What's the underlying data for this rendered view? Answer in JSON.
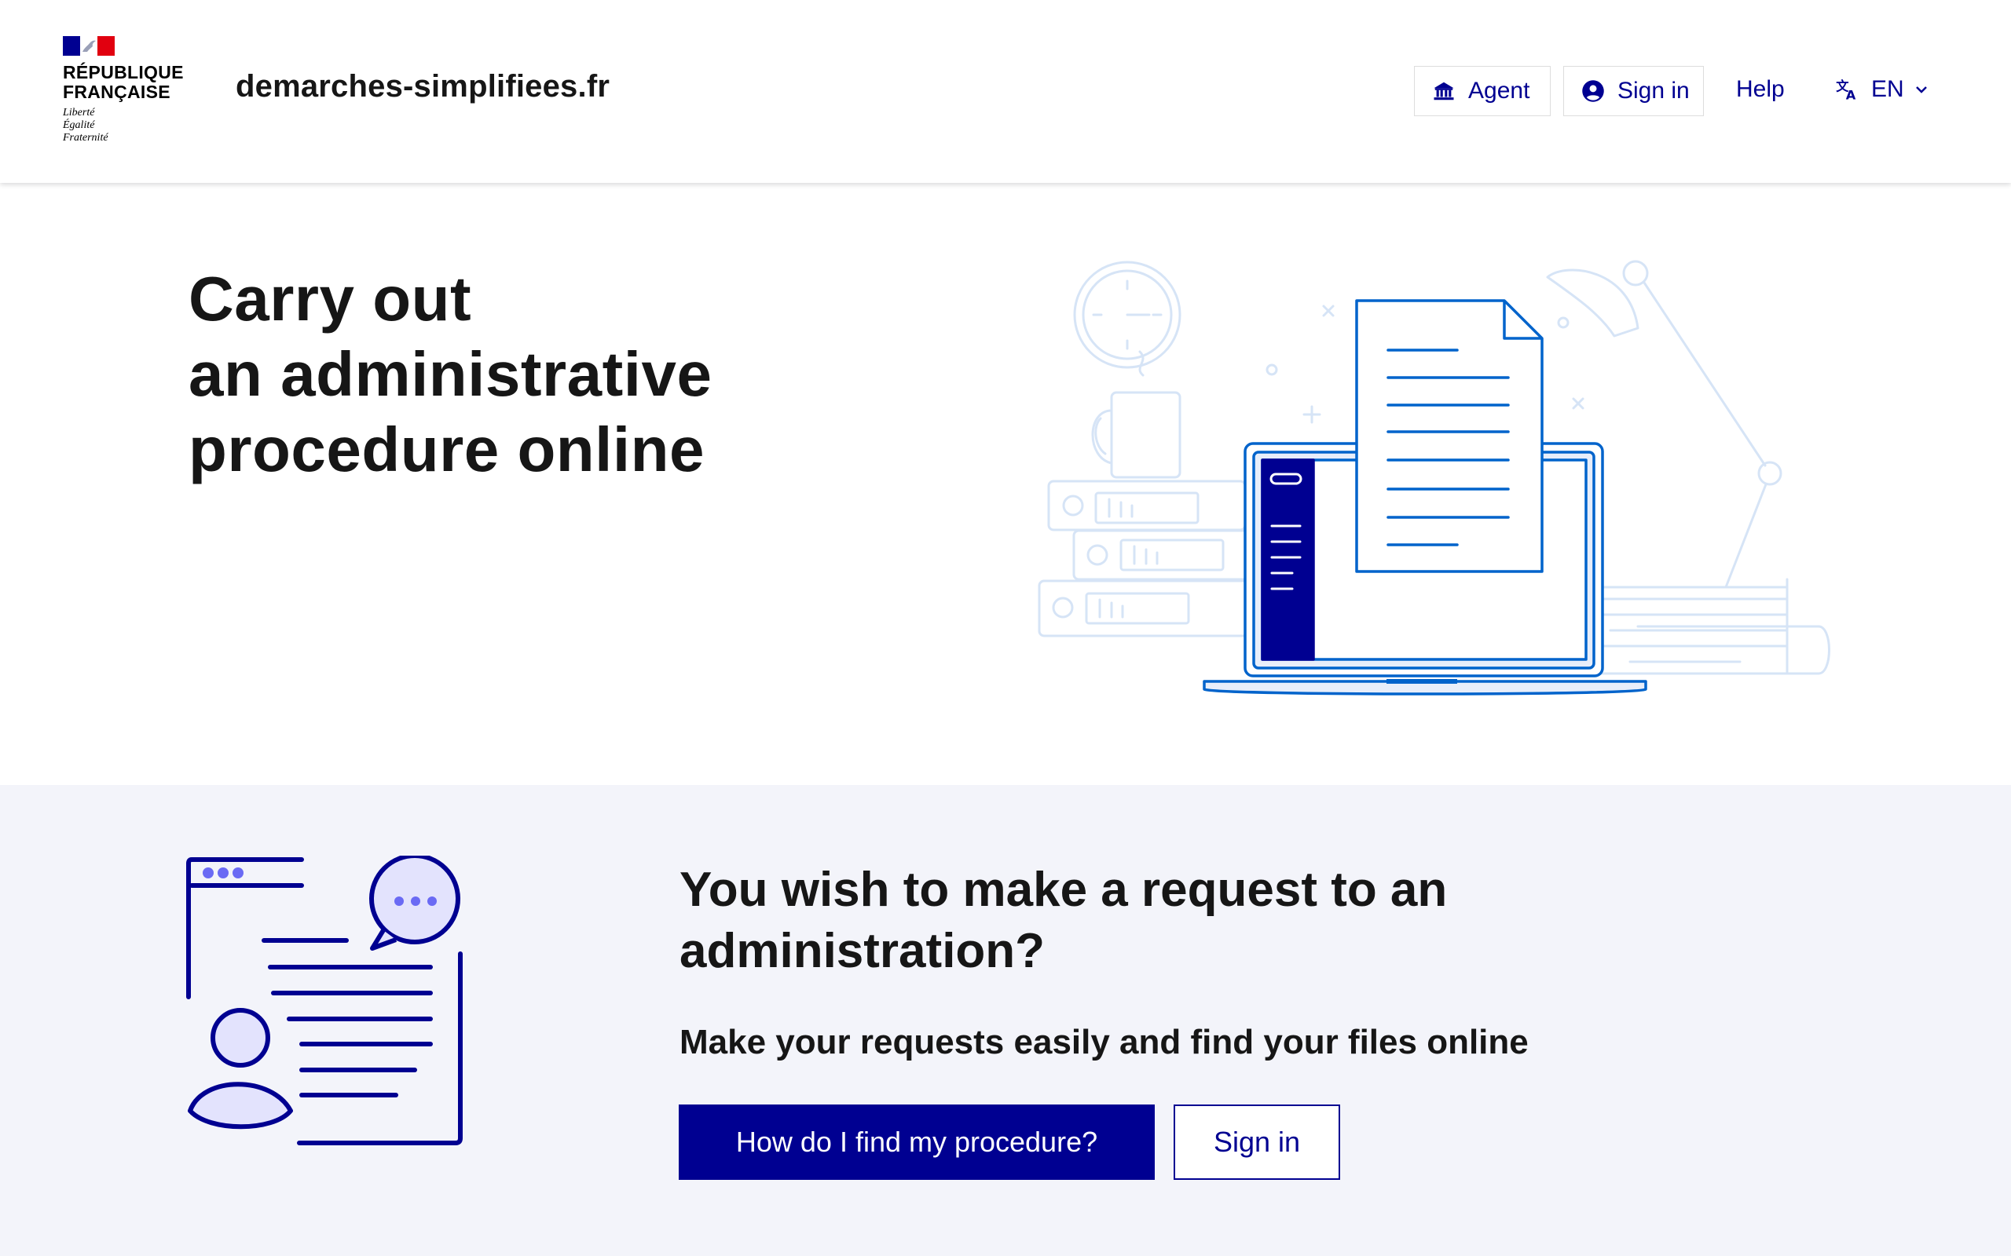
{
  "header": {
    "logo": {
      "wordmark": "RÉPUBLIQUE\nFRANÇAISE",
      "motto": "Liberté\nÉgalité\nFraternité"
    },
    "site_name": "demarches-simplifiees.fr",
    "agent_label": "Agent",
    "signin_label": "Sign in",
    "help_label": "Help",
    "language": "EN"
  },
  "hero": {
    "title_line1": "Carry out",
    "title_line2": "an administrative",
    "title_line3": "procedure online"
  },
  "request": {
    "title": "You wish to make a request to an administration?",
    "subtitle": "Make your requests easily and find your files online",
    "primary_button": "How do I find my procedure?",
    "secondary_button": "Sign in"
  },
  "colors": {
    "brand_blue": "#000091",
    "france_red": "#e1000f",
    "illustration_blue": "#0063cb",
    "section_background": "#f3f4fa"
  },
  "icons": [
    "marianne-flag",
    "bank-icon",
    "account-circle-icon",
    "translate-icon",
    "chevron-down-icon"
  ]
}
